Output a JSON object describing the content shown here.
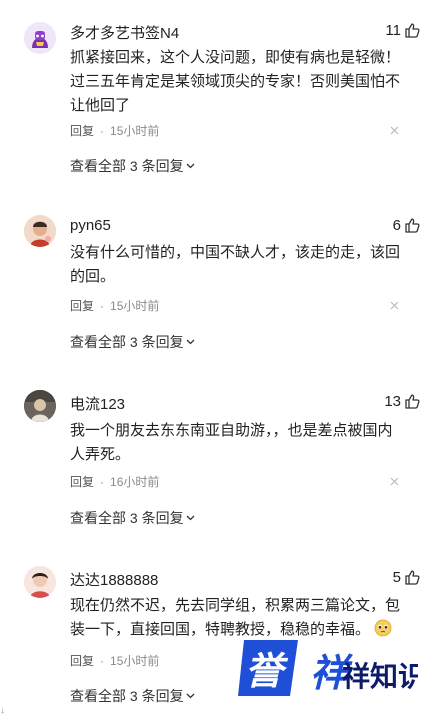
{
  "comments": [
    {
      "username": "多才多艺书签N4",
      "likes": "11",
      "text": "抓紧接回来，这个人没问题，即使有病也是轻微！过三五年肯定是某领域顶尖的专家！否则美国怕不让他回了",
      "reply_label": "回复",
      "time": "15小时前",
      "view_replies": "查看全部 3 条回复"
    },
    {
      "username": "pyn65",
      "likes": "6",
      "text": "没有什么可惜的，中国不缺人才，该走的走，该回的回。",
      "reply_label": "回复",
      "time": "15小时前",
      "view_replies": "查看全部 3 条回复"
    },
    {
      "username": "电流123",
      "likes": "13",
      "text": "我一个朋友去东东南亚自助游，，也是差点被国内人弄死。",
      "reply_label": "回复",
      "time": "16小时前",
      "view_replies": "查看全部 3 条回复"
    },
    {
      "username": "达达1888888",
      "likes": "5",
      "text": "现在仍然不迟，先去同学组，积累两三篇论文，包装一下，直接回国，特聘教授，稳稳的幸福。",
      "reply_label": "回复",
      "time": "15小时前",
      "view_replies": "查看全部 3 条回复"
    }
  ],
  "watermark": {
    "text": "誉祥祥知识",
    "color_blue": "#1f4fd6",
    "color_navy": "#0d1b6b"
  },
  "icons": {
    "like": "thumbs-up-icon",
    "close": "close-icon",
    "chevron": "chevron-down-icon",
    "emoji": "pleading-face-emoji"
  }
}
